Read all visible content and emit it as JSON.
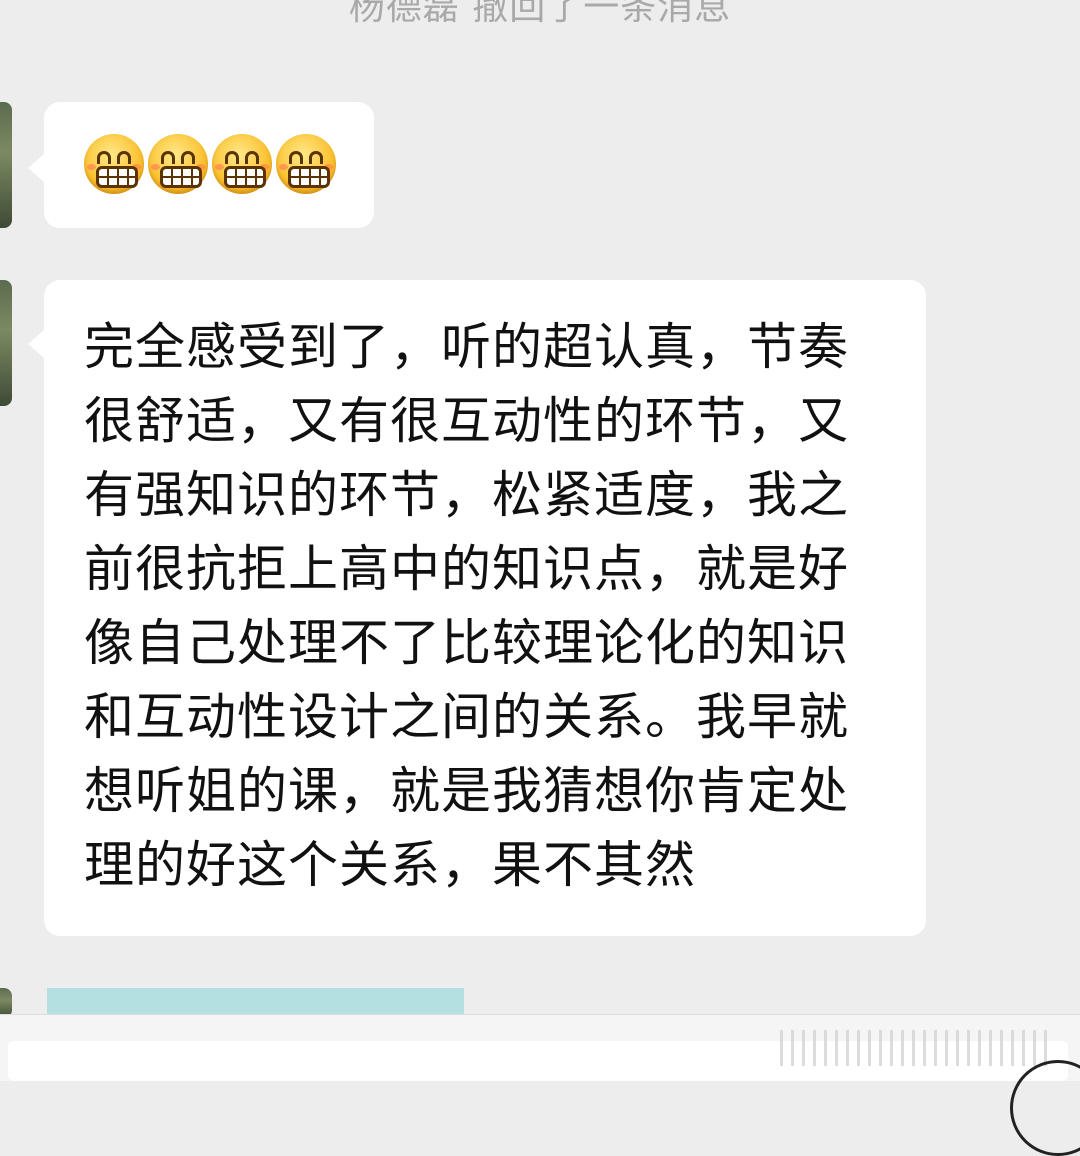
{
  "system_notice": "杨德磊 撤回了一条消息",
  "messages": [
    {
      "sender_side": "left",
      "type": "emoji",
      "emoji": [
        "grimacing-face-icon",
        "grimacing-face-icon",
        "grimacing-face-icon",
        "grimacing-face-icon"
      ]
    },
    {
      "sender_side": "left",
      "type": "text",
      "text": "完全感受到了，听的超认真，节奏很舒适，又有很互动性的环节，又有强知识的环节，松紧适度，我之前很抗拒上高中的知识点，就是好像自己处理不了比较理论化的知识和互动性设计之间的关系。我早就想听姐的课，就是我猜想你肯定处理的好这个关系，果不其然"
    }
  ],
  "colors": {
    "background": "#ededed",
    "bubble": "#ffffff",
    "text": "#111111",
    "notice": "#a9a9a9",
    "partial_attachment": "#b4e0e1"
  }
}
